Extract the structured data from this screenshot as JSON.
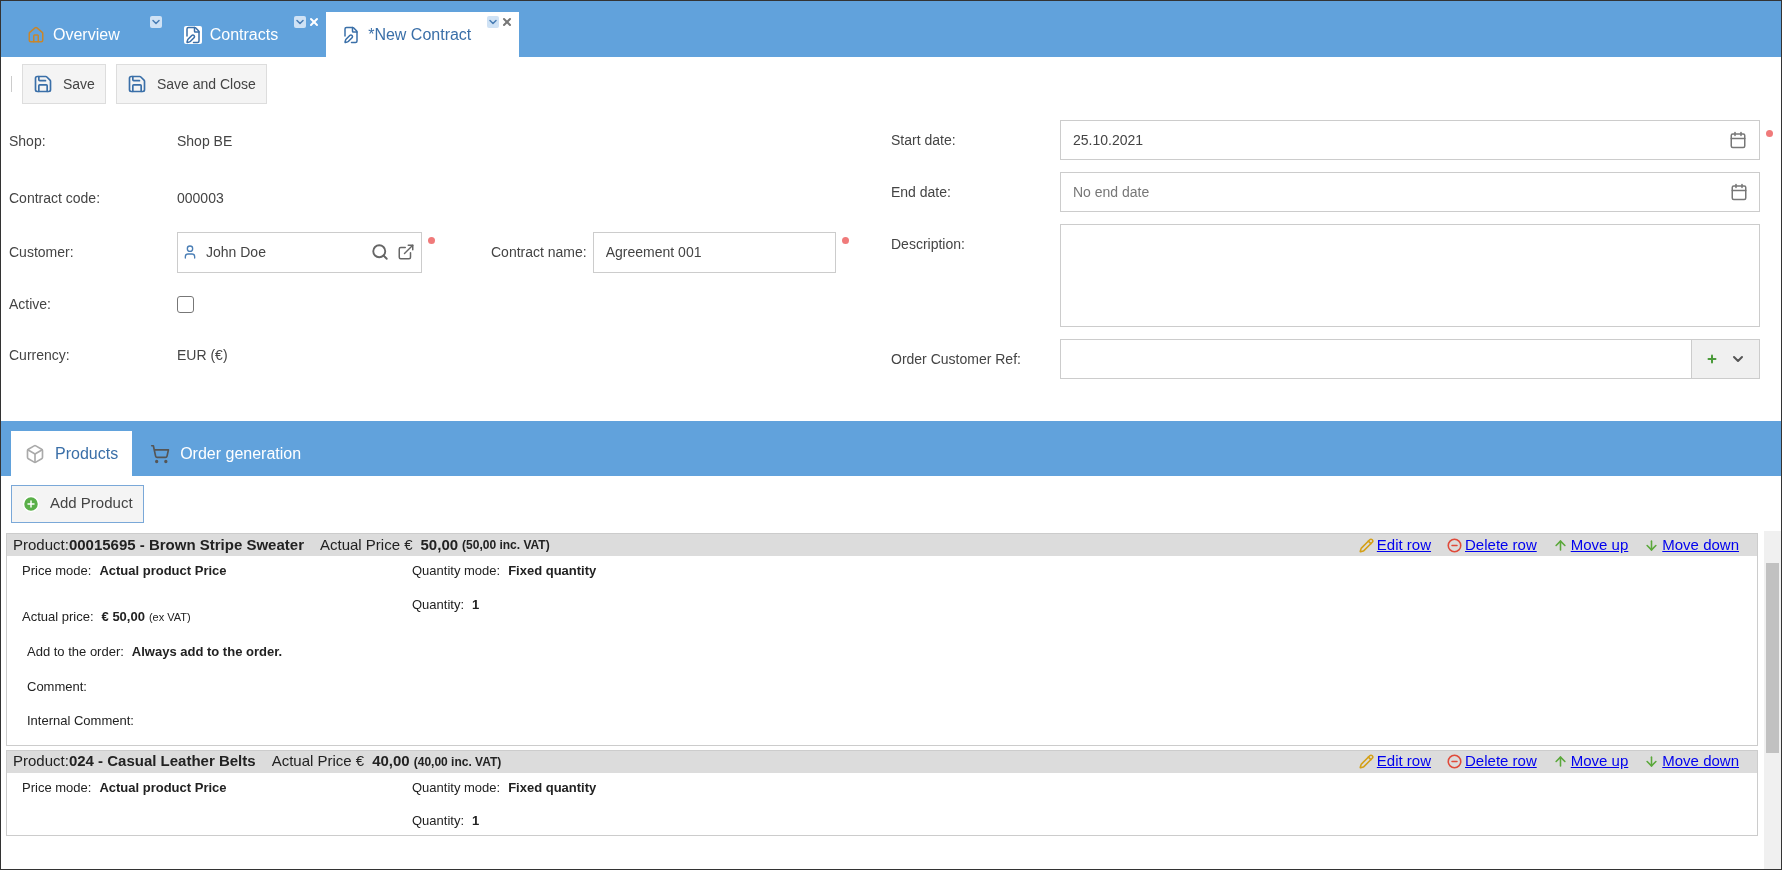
{
  "tabs": [
    {
      "label": "Overview",
      "kind": "home",
      "selected": false,
      "closable": false
    },
    {
      "label": "Contracts",
      "kind": "document",
      "selected": false,
      "closable": true
    },
    {
      "label": "*New Contract",
      "kind": "document",
      "selected": true,
      "closable": true
    }
  ],
  "toolbar": [
    "Save",
    "Save and Close"
  ],
  "form": {
    "shop": {
      "label": "Shop:",
      "value": "Shop BE"
    },
    "contract_code": {
      "label": "Contract code:",
      "value": "000003"
    },
    "customer": {
      "label": "Customer:",
      "value": "John Doe",
      "required": true
    },
    "contract_name": {
      "label": "Contract name:",
      "value": "Agreement 001",
      "required": true
    },
    "active": {
      "label": "Active:",
      "checked": false
    },
    "currency": {
      "label": "Currency:",
      "value": "EUR (€)"
    },
    "start_date": {
      "label": "Start date:",
      "value": "25.10.2021",
      "required": true
    },
    "end_date": {
      "label": "End date:",
      "placeholder": "No end date"
    },
    "description": {
      "label": "Description:"
    },
    "order_customer_ref": {
      "label": "Order Customer Ref:"
    }
  },
  "section_tabs": [
    {
      "label": "Products",
      "kind": "box",
      "selected": true
    },
    {
      "label": "Order generation",
      "kind": "cart",
      "selected": false
    }
  ],
  "add_product": "Add Product",
  "products": [
    {
      "prefix": "Product:",
      "name": "00015695 - Brown Stripe Sweater",
      "price_label": "Actual Price €",
      "price": "50,00",
      "price_incl": "(50,00 inc. VAT)",
      "actions": [
        {
          "label": "Edit row",
          "kind": "edit"
        },
        {
          "label": "Delete row",
          "kind": "delete"
        },
        {
          "label": "Move up",
          "kind": "up"
        },
        {
          "label": "Move down",
          "kind": "down"
        }
      ],
      "price_mode": {
        "label": "Price mode:",
        "value": "Actual product Price"
      },
      "quantity_mode": {
        "label": "Quantity mode:",
        "value": "Fixed quantity"
      },
      "quantity": {
        "label": "Quantity:",
        "value": "1"
      },
      "actual_price": {
        "label": "Actual price:",
        "value": "€ 50,00",
        "note": "(ex VAT)"
      },
      "add_to_order": {
        "label": "Add to the order:",
        "value": "Always add to the order."
      },
      "comment": {
        "label": "Comment:"
      },
      "internal_comment": {
        "label": "Internal Comment:"
      }
    },
    {
      "prefix": "Product:",
      "name": "024 - Casual Leather Belts",
      "price_label": "Actual Price €",
      "price": "40,00",
      "price_incl": "(40,00 inc. VAT)",
      "actions": [
        {
          "label": "Edit row",
          "kind": "edit"
        },
        {
          "label": "Delete row",
          "kind": "delete"
        },
        {
          "label": "Move up",
          "kind": "up"
        },
        {
          "label": "Move down",
          "kind": "down"
        }
      ],
      "price_mode": {
        "label": "Price mode:",
        "value": "Actual product Price"
      },
      "quantity_mode": {
        "label": "Quantity mode:",
        "value": "Fixed quantity"
      },
      "quantity": {
        "label": "Quantity:",
        "value": "1"
      }
    }
  ]
}
